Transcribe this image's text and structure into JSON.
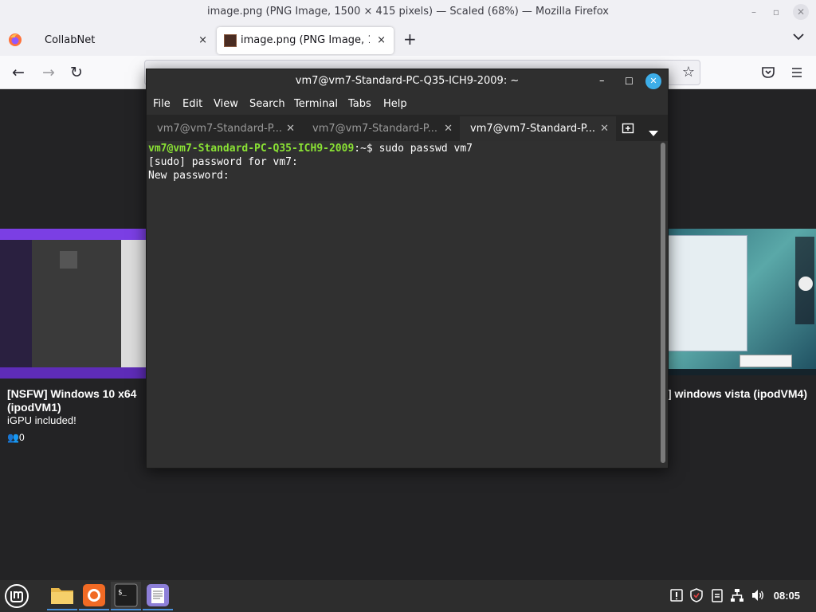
{
  "firefox": {
    "window_title": "image.png (PNG Image, 1500 × 415 pixels) — Scaled (68%) — Mozilla Firefox",
    "tabs": [
      {
        "label": "CollabNet",
        "close": "×"
      },
      {
        "label": "image.png (PNG Image, 150",
        "close": "×"
      }
    ],
    "new_tab": "+"
  },
  "page": {
    "cards": [
      {
        "title": "[NSFW] Windows 10 x64 (ipodVM1)",
        "subtitle": "iGPU included!",
        "viewers": "0"
      },
      {
        "title": "] windows vista (ipodVM4)"
      }
    ]
  },
  "terminal": {
    "title": "vm7@vm7-Standard-PC-Q35-ICH9-2009: ~",
    "menu": [
      "File",
      "Edit",
      "View",
      "Search",
      "Terminal",
      "Tabs",
      "Help"
    ],
    "tabs": [
      {
        "label": "vm7@vm7-Standard-P...",
        "active": false
      },
      {
        "label": "vm7@vm7-Standard-P...",
        "active": false
      },
      {
        "label": "vm7@vm7-Standard-P...",
        "active": true
      }
    ],
    "prompt_user_host": "vm7@vm7-Standard-PC-Q35-ICH9-2009",
    "prompt_path": ":~$ ",
    "command": "sudo passwd vm7",
    "output_lines": [
      "[sudo] password for vm7:",
      "New password:"
    ]
  },
  "panel": {
    "apps": [
      "mint-menu-icon",
      "files-icon",
      "firefox-icon",
      "terminal-icon",
      "text-editor-icon"
    ],
    "clock": "08:05"
  },
  "colors": {
    "prompt_green": "#8ae234",
    "terminal_bg": "#303030",
    "panel_bg": "#2d2d2d",
    "accent": "#4a90d9"
  }
}
